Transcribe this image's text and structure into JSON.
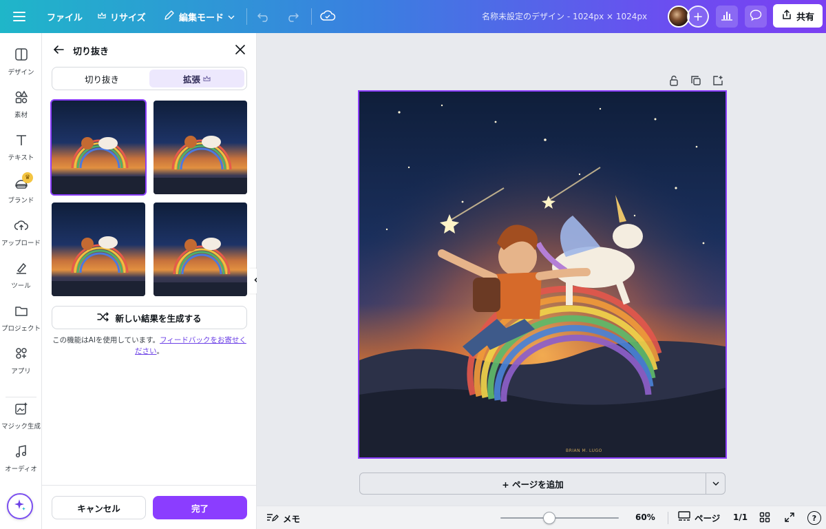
{
  "topbar": {
    "file_label": "ファイル",
    "resize_label": "リサイズ",
    "edit_mode_label": "編集モード",
    "doc_title": "名称未設定のデザイン - 1024px × 1024px",
    "share_label": "共有"
  },
  "rail": {
    "items": [
      {
        "label": "デザイン",
        "icon": "design-icon"
      },
      {
        "label": "素材",
        "icon": "elements-icon"
      },
      {
        "label": "テキスト",
        "icon": "text-icon"
      },
      {
        "label": "ブランド",
        "icon": "brand-icon"
      },
      {
        "label": "アップロード",
        "icon": "upload-icon"
      },
      {
        "label": "ツール",
        "icon": "tools-icon"
      },
      {
        "label": "プロジェクト",
        "icon": "folder-icon"
      },
      {
        "label": "アプリ",
        "icon": "apps-icon"
      },
      {
        "label": "マジック生成",
        "icon": "magic-media-icon"
      },
      {
        "label": "オーディオ",
        "icon": "audio-icon"
      }
    ]
  },
  "panel": {
    "title": "切り抜き",
    "tabs": [
      {
        "label": "切り抜き",
        "active": false
      },
      {
        "label": "拡張",
        "active": true
      }
    ],
    "generate_label": "新しい結果を生成する",
    "ai_note_prefix": "この機能はAIを使用しています。",
    "ai_note_link": "フィードバックをお寄せください",
    "ai_note_suffix": "。",
    "cancel_label": "キャンセル",
    "done_label": "完了"
  },
  "canvas": {
    "add_page_label": "+ ページを追加",
    "signature": "BRIAN M. LUGO"
  },
  "bottombar": {
    "memo_label": "メモ",
    "zoom": "60%",
    "zoom_level": 0.41,
    "pages_label": "ページ",
    "page_count": "1/1",
    "help_label": "?"
  },
  "colors": {
    "accent": "#8b3dff",
    "accent_light": "#ede8fd"
  }
}
